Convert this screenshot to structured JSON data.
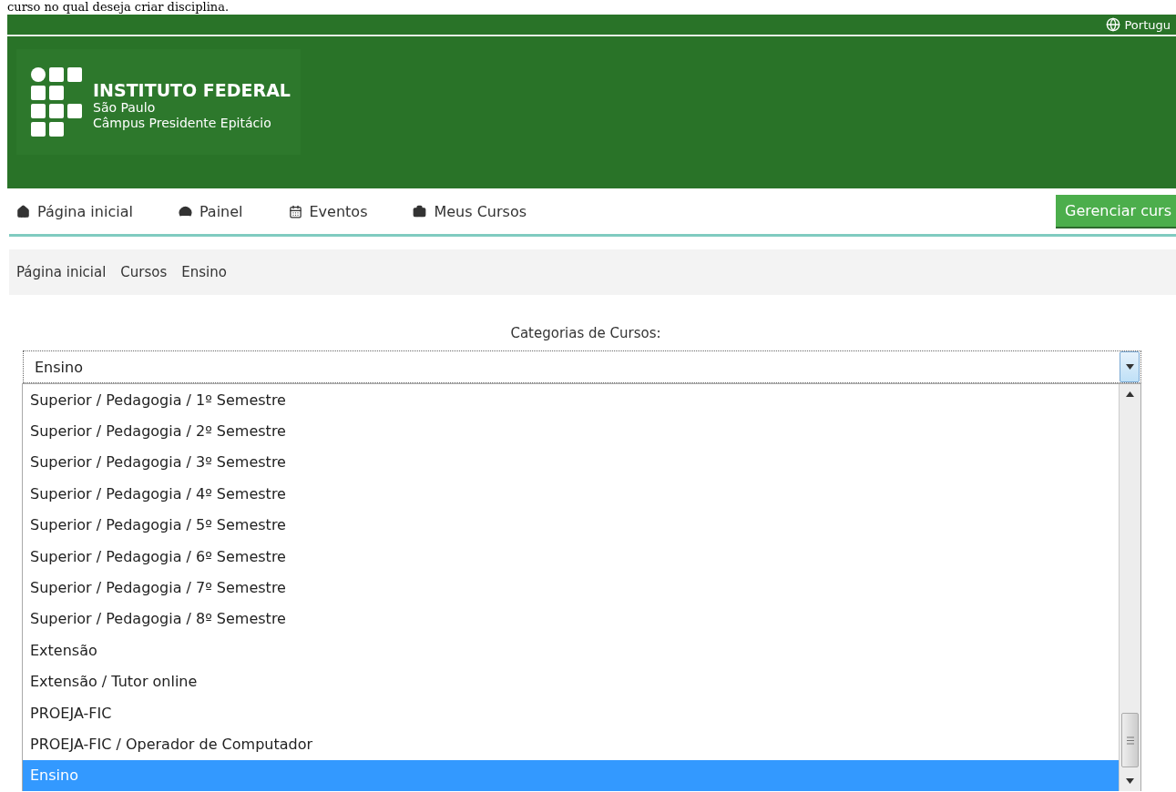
{
  "intro_text": "curso no qual deseja criar disciplina.",
  "header": {
    "language": "Portugu",
    "logo": {
      "title": "INSTITUTO FEDERAL",
      "subtitle": "São Paulo",
      "campus": "Câmpus Presidente Epitácio"
    }
  },
  "nav": {
    "items": [
      {
        "label": "Página inicial"
      },
      {
        "label": "Painel"
      },
      {
        "label": "Eventos"
      },
      {
        "label": "Meus Cursos"
      }
    ],
    "button": "Gerenciar curs"
  },
  "breadcrumb": [
    "Página inicial",
    "Cursos",
    "Ensino"
  ],
  "category_label": "Categorias de Cursos:",
  "select": {
    "value": "Ensino",
    "options": [
      {
        "label": "Superior / Pedagogia / 1º Semestre",
        "selected": false
      },
      {
        "label": "Superior / Pedagogia / 2º Semestre",
        "selected": false
      },
      {
        "label": "Superior / Pedagogia / 3º Semestre",
        "selected": false
      },
      {
        "label": "Superior / Pedagogia / 4º Semestre",
        "selected": false
      },
      {
        "label": "Superior / Pedagogia / 5º Semestre",
        "selected": false
      },
      {
        "label": "Superior / Pedagogia / 6º Semestre",
        "selected": false
      },
      {
        "label": "Superior / Pedagogia / 7º Semestre",
        "selected": false
      },
      {
        "label": "Superior / Pedagogia / 8º Semestre",
        "selected": false
      },
      {
        "label": "Extensão",
        "selected": false
      },
      {
        "label": "Extensão / Tutor online",
        "selected": false
      },
      {
        "label": "PROEJA-FIC",
        "selected": false
      },
      {
        "label": "PROEJA-FIC / Operador de Computador",
        "selected": false
      },
      {
        "label": "Ensino",
        "selected": true
      }
    ]
  }
}
